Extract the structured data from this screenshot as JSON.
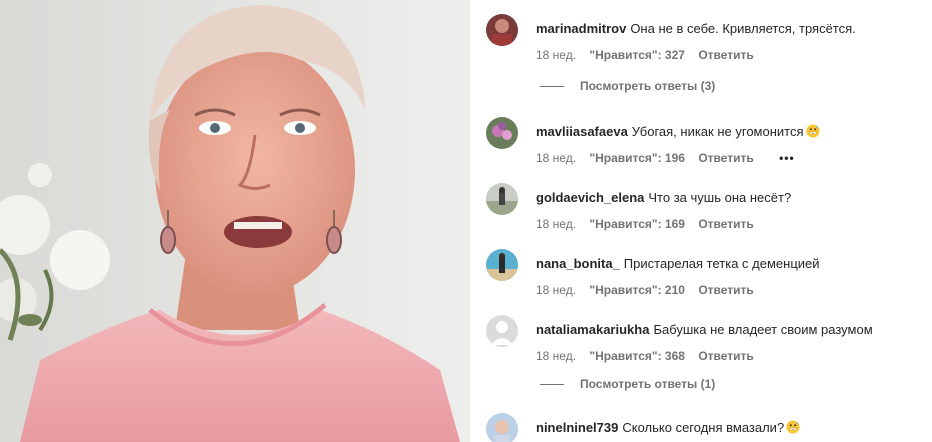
{
  "comments": [
    {
      "username": "marinadmitrov",
      "text": "Она не в себе. Кривляется, трясётся.",
      "age": "18 нед.",
      "likes": "\"Нравится\": 327",
      "reply": "Ответить",
      "emoji": "",
      "view_replies": "Посмотреть ответы (3)"
    },
    {
      "username": "mavliiasafaeva",
      "text": "Убогая, никак не угомонится",
      "age": "18 нед.",
      "likes": "\"Нравится\": 196",
      "reply": "Ответить",
      "emoji": "grinning-sweat-emoji",
      "more": "•••"
    },
    {
      "username": "goldaevich_elena",
      "text": "Что за чушь она несёт?",
      "age": "18 нед.",
      "likes": "\"Нравится\": 169",
      "reply": "Ответить"
    },
    {
      "username": "nana_bonita_",
      "text": "Пристарелая тетка с деменцией",
      "age": "18 нед.",
      "likes": "\"Нравится\": 210",
      "reply": "Ответить"
    },
    {
      "username": "nataliamakariukha",
      "text": "Бабушка не владеет своим разумом",
      "age": "18 нед.",
      "likes": "\"Нравится\": 368",
      "reply": "Ответить",
      "view_replies": "Посмотреть ответы (1)"
    },
    {
      "username": "ninelninel739",
      "text": "Сколько сегодня вмазали?",
      "emoji": "grinning-sweat-emoji"
    }
  ],
  "colors": {
    "username": "#262626",
    "meta": "#737373",
    "blouse": "#f0a9ad"
  }
}
